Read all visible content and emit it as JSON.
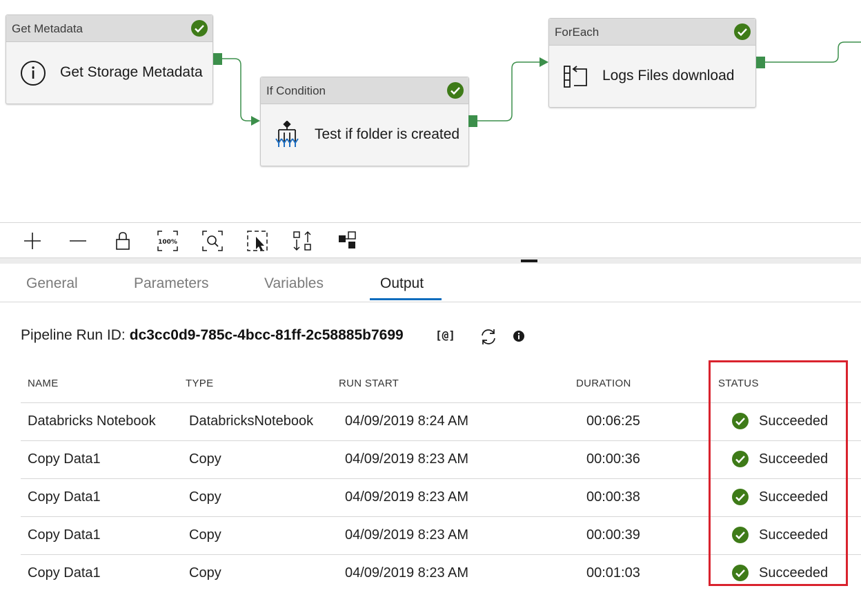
{
  "pipeline": {
    "activities": [
      {
        "type": "Get Metadata",
        "name": "Get Storage Metadata",
        "icon": "info-icon",
        "status": "succeeded"
      },
      {
        "type": "If Condition",
        "name": "Test if folder is created",
        "icon": "if-condition-icon",
        "status": "succeeded"
      },
      {
        "type": "ForEach",
        "name": "Logs Files download",
        "icon": "foreach-icon",
        "status": "succeeded"
      }
    ],
    "connector_color": "#3c8f4b",
    "success_color": "#3e7b18"
  },
  "toolbar": {
    "zoom_in": "zoom-in-icon",
    "zoom_out": "zoom-out-icon",
    "lock": "lock-icon",
    "zoom_100_label": "100%",
    "zoom_fit": "zoom-to-fit-icon",
    "select": "multi-select-icon",
    "auto_align": "auto-align-icon",
    "layout": "layout-icon"
  },
  "tabs": [
    "General",
    "Parameters",
    "Variables",
    "Output"
  ],
  "active_tab": "Output",
  "accent_color": "#0f6cbd",
  "run": {
    "label": "Pipeline Run ID:",
    "id": "dc3cc0d9-785c-4bcc-81ff-2c58885b7699",
    "copy_icon_label": "[@]"
  },
  "table": {
    "headers": [
      "NAME",
      "TYPE",
      "RUN START",
      "DURATION",
      "STATUS"
    ],
    "rows": [
      {
        "name": "Databricks Notebook",
        "type": "DatabricksNotebook",
        "run_start": "04/09/2019 8:24 AM",
        "duration": "00:06:25",
        "status": "Succeeded"
      },
      {
        "name": "Copy Data1",
        "type": "Copy",
        "run_start": "04/09/2019 8:23 AM",
        "duration": "00:00:36",
        "status": "Succeeded"
      },
      {
        "name": "Copy Data1",
        "type": "Copy",
        "run_start": "04/09/2019 8:23 AM",
        "duration": "00:00:38",
        "status": "Succeeded"
      },
      {
        "name": "Copy Data1",
        "type": "Copy",
        "run_start": "04/09/2019 8:23 AM",
        "duration": "00:00:39",
        "status": "Succeeded"
      },
      {
        "name": "Copy Data1",
        "type": "Copy",
        "run_start": "04/09/2019 8:23 AM",
        "duration": "00:01:03",
        "status": "Succeeded"
      }
    ],
    "highlight_color": "#d9232e"
  }
}
